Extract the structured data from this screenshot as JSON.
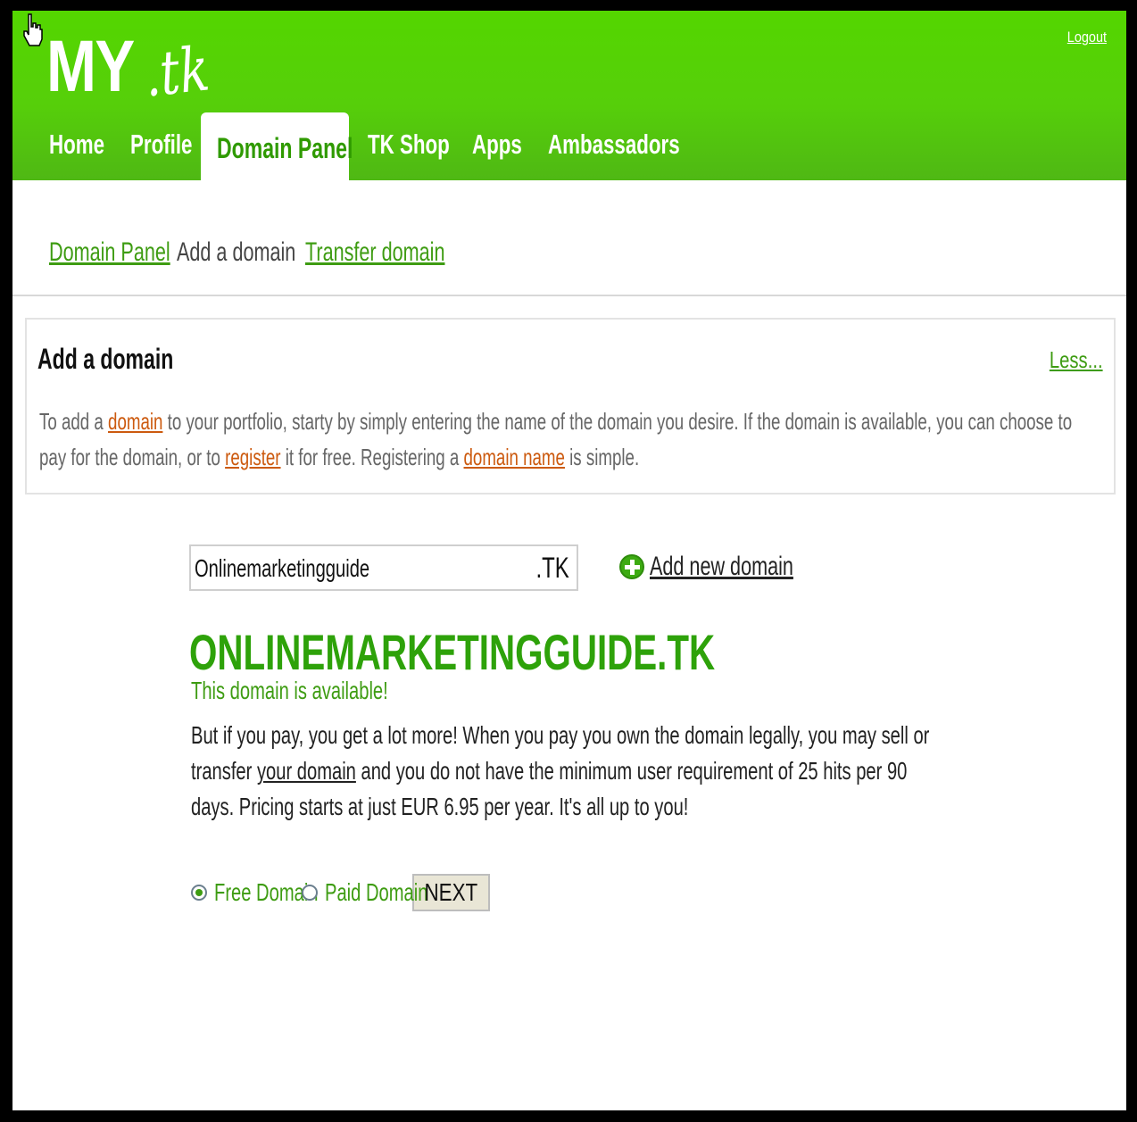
{
  "header": {
    "logo_my": "MY",
    "logo_tk": ".tk",
    "logout": "Logout"
  },
  "nav": {
    "items": [
      "Home",
      "Profile",
      "Domain Panel",
      "TK Shop",
      "Apps",
      "Ambassadors"
    ],
    "active_index": 2
  },
  "subnav": {
    "items": [
      "Domain Panel",
      "Add a domain",
      "Transfer domain"
    ]
  },
  "info": {
    "title": "Add a domain",
    "less": "Less...",
    "text_parts": [
      "To add a ",
      "domain",
      " to your portfolio, starty by simply entering the name of the domain you desire. If the domain is available, you can choose to pay for the domain, or to ",
      "register",
      " it for free. Registering a ",
      "domain name",
      " is simple."
    ]
  },
  "search": {
    "value": "Onlinemarketingguide",
    "suffix": ".TK",
    "add_new": "Add new domain"
  },
  "result": {
    "domain": "ONLINEMARKETINGGUIDE.TK",
    "status": "This domain is available!",
    "desc_parts": [
      "But if you pay, you get a lot more! When you pay you own the domain legally, you may sell or transfer ",
      "your domain",
      " and you do not have the minimum user requirement of 25 hits per 90 days. Pricing starts at just EUR 6.95 per year. It's all up to you!"
    ]
  },
  "options": {
    "free_label": "Free Domain",
    "paid_label": "Paid Domain",
    "selected": "free",
    "next": "NEXT"
  },
  "colors": {
    "brand_green": "#54d600",
    "link_green": "#3e9c12",
    "domain_green": "#2ea20a",
    "link_orange": "#cc5a0f"
  }
}
